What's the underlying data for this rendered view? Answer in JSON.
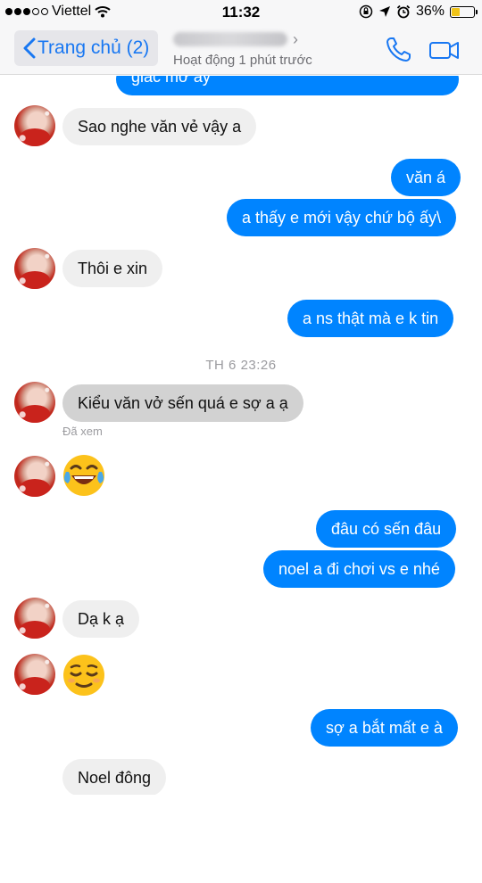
{
  "status_bar": {
    "carrier": "Viettel",
    "time": "11:32",
    "battery_percent": "36%",
    "battery_level": 0.36,
    "signal_icon": "signal-dots-icon",
    "wifi_icon": "wifi-icon",
    "lock_icon": "orientation-lock-icon",
    "location_icon": "location-arrow-icon",
    "alarm_icon": "alarm-clock-icon"
  },
  "header": {
    "back_label": "Trang chủ (2)",
    "subtitle": "Hoạt động 1 phút trước",
    "accent_color": "#1877f2"
  },
  "messages": {
    "m0": "giác mơ ấy",
    "m1": "Sao nghe văn vẻ vậy a",
    "m2": "văn á",
    "m3": "a thấy e mới vậy chứ bộ ấy\\",
    "m4": "Thôi e xin",
    "m5": "a ns thật mà e k tin",
    "timestamp": "TH 6 23:26",
    "m6": "Kiểu văn vở sến quá e sợ a ạ",
    "seen": "Đã xem",
    "m7_emoji": "laughing-tears-emoji",
    "m8": "đâu có sến đâu",
    "m9": "noel a đi chơi vs e nhé",
    "m10": "Dạ k ạ",
    "m11_emoji": "relieved-face-emoji",
    "m12": "sợ a bắt mất e à",
    "m13": "Noel đông"
  },
  "colors": {
    "outgoing_bubble": "#0084ff",
    "incoming_bubble": "#efefef"
  }
}
